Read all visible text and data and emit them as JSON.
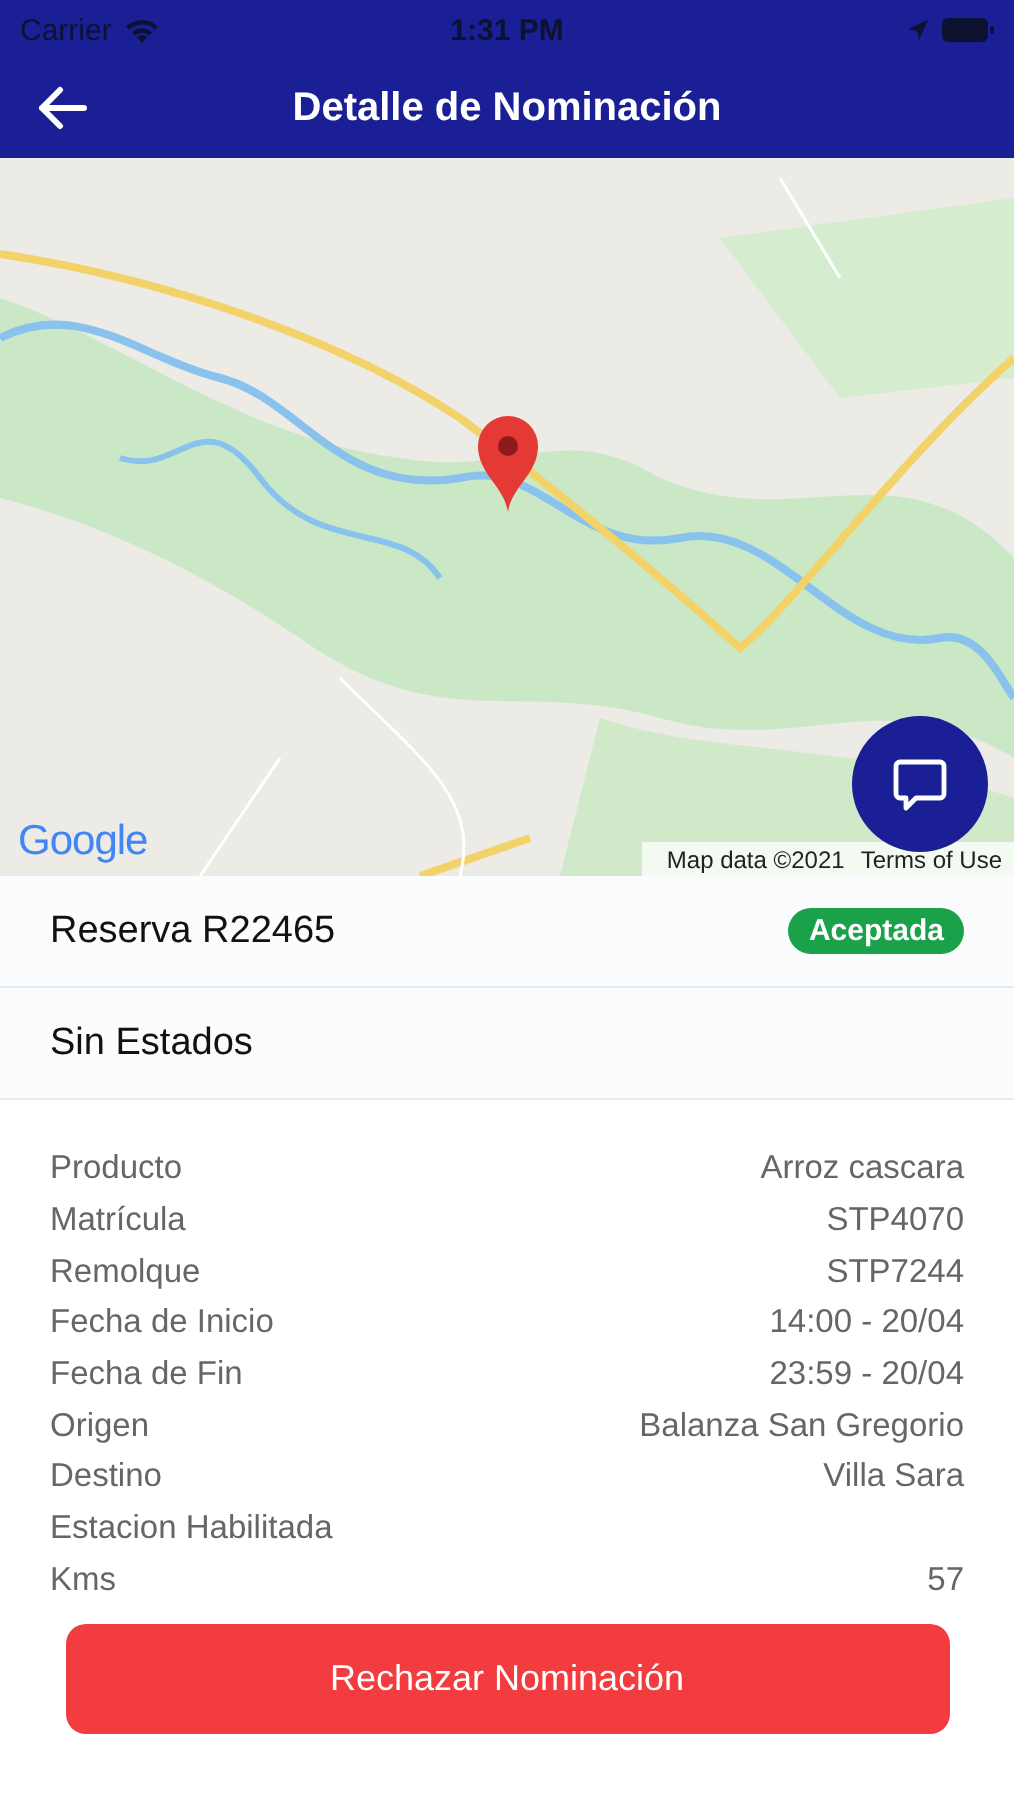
{
  "status_bar": {
    "carrier": "Carrier",
    "time": "1:31 PM"
  },
  "header": {
    "title": "Detalle de Nominación"
  },
  "map": {
    "kind": "picture",
    "logo": "Google",
    "attribution": "Map data ©2021",
    "terms": "Terms of Use"
  },
  "reservation": {
    "title": "Reserva R22465",
    "status": "Aceptada",
    "color": "#1aa14a"
  },
  "states": {
    "title": "Sin Estados"
  },
  "details": [
    {
      "label": "Producto",
      "value": "Arroz cascara"
    },
    {
      "label": "Matrícula",
      "value": "STP4070"
    },
    {
      "label": "Remolque",
      "value": "STP7244"
    },
    {
      "label": "Fecha de Inicio",
      "value": "14:00 - 20/04"
    },
    {
      "label": "Fecha de Fin",
      "value": "23:59 - 20/04"
    },
    {
      "label": "Origen",
      "value": "Balanza San Gregorio"
    },
    {
      "label": "Destino",
      "value": "Villa Sara"
    },
    {
      "label": "Estacion Habilitada"
    },
    {
      "label": "Kms",
      "value": "57"
    }
  ],
  "reject_button": {
    "label": "Rechazar Nominación"
  }
}
